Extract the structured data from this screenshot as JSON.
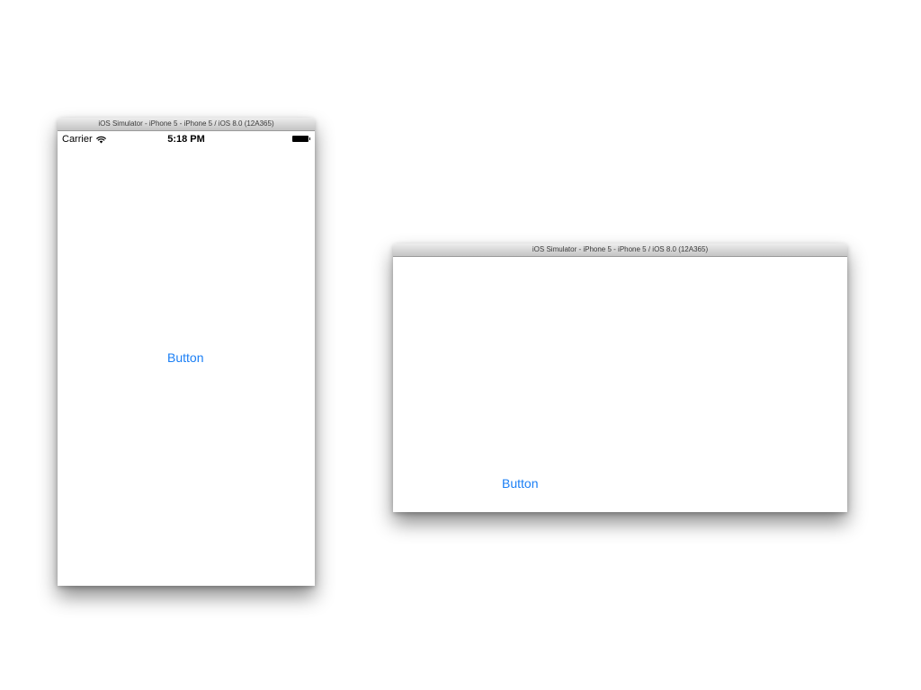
{
  "portrait_window": {
    "title": "iOS Simulator - iPhone 5 - iPhone 5 / iOS 8.0 (12A365)",
    "status_bar": {
      "carrier": "Carrier",
      "time": "5:18 PM"
    },
    "button_label": "Button"
  },
  "landscape_window": {
    "title": "iOS Simulator - iPhone 5 - iPhone 5 / iOS 8.0 (12A365)",
    "button_label": "Button"
  },
  "colors": {
    "button_tint": "#1b7ff5",
    "screen_background": "#ffffff"
  },
  "icons": {
    "wifi": "wifi-icon",
    "battery": "battery-icon"
  }
}
